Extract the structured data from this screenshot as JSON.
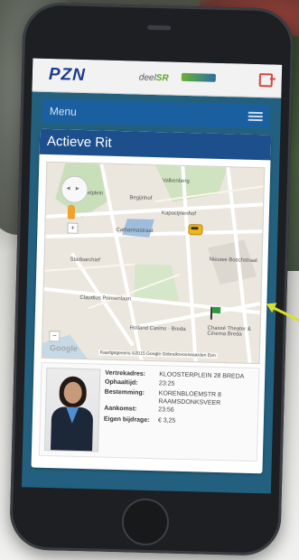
{
  "header": {
    "logo_primary": "PZN",
    "logo_secondary": "deel",
    "logo_secondary_highlight": "SR"
  },
  "menu": {
    "label": "Menu"
  },
  "card": {
    "title": "Actieve Rit"
  },
  "map": {
    "labels": {
      "l1": "Valkenberg",
      "l2": "Kasteelplein",
      "l3": "Begijnhof",
      "l4": "Kapucijnenhof",
      "l5": "Catharinastraat",
      "l6": "Stadsarchief",
      "l7": "Holland Casino · Breda",
      "l8": "Chassé Theater & Cinema Breda",
      "l9": "Nieuwe Boschstraat",
      "l10": "Claudius Prinsenlaan"
    },
    "google_text": "Google",
    "footer_text": "Kaartgegevens ©2015 Google   Gebruiksvoorwaarden   Een"
  },
  "ride": {
    "pickup_address_label": "Vertrekadres:",
    "pickup_address_value": "KLOOSTERPLEIN 28 BREDA",
    "pickup_time_label": "Ophaaltijd:",
    "pickup_time_value": "23:25",
    "destination_label": "Bestemming:",
    "destination_value": "KORENBLOEMSTR 8 RAAMSDONKSVEER",
    "arrival_label": "Aankomst:",
    "arrival_value": "23:56",
    "contribution_label": "Eigen bijdrage:",
    "contribution_value": "€ 3,25"
  },
  "colors": {
    "header_blue": "#1d4f8d",
    "menu_blue": "#1a5fa0",
    "screen_bg": "#23607f",
    "taxi_yellow": "#f0b61a",
    "flag_green": "#2c9a3a",
    "pointer_arrow": "#d7e02c"
  }
}
